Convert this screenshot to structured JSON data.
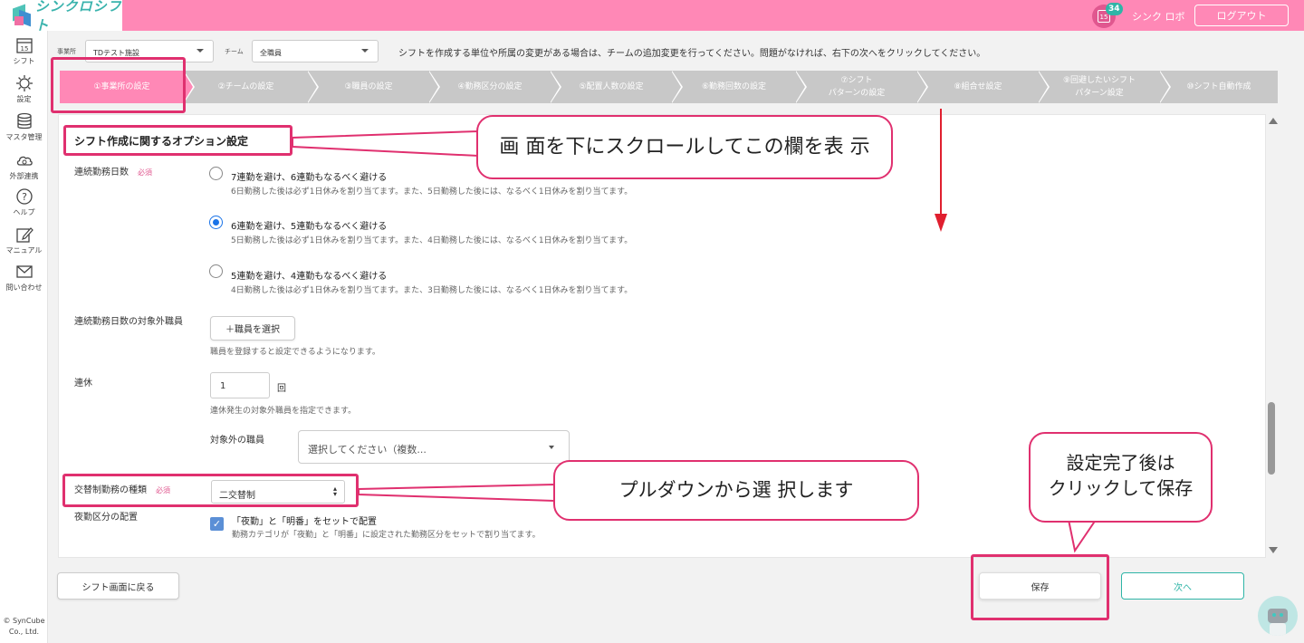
{
  "app": {
    "logo_text": "シンクロシフト",
    "calendar_day": "15",
    "notification_count": "34",
    "user_name": "シンク ロボ",
    "logout_label": "ログアウト",
    "brand_color": "#ff88b6",
    "accent_color": "#2fb5a7"
  },
  "sidebar": {
    "items": [
      {
        "label": "シフト",
        "icon": "calendar-icon",
        "day": "15"
      },
      {
        "label": "設定",
        "icon": "gear-icon"
      },
      {
        "label": "マスタ管理",
        "icon": "database-icon"
      },
      {
        "label": "外部連携",
        "icon": "cloud-sync-icon"
      },
      {
        "label": "ヘルプ",
        "icon": "help-icon"
      },
      {
        "label": "マニュアル",
        "icon": "edit-icon"
      },
      {
        "label": "問い合わせ",
        "icon": "mail-icon"
      }
    ],
    "copyright_line1": "© SynCube",
    "copyright_line2": "Co., Ltd."
  },
  "filters": {
    "office_label": "事業所",
    "office_value": "TDテスト施設",
    "team_label": "チーム",
    "team_value": "全職員",
    "instruction": "シフトを作成する単位や所属の変更がある場合は、チームの追加変更を行ってください。問題がなければ、右下の次へをクリックしてください。"
  },
  "steps": [
    {
      "label": "①事業所の設定",
      "active": true
    },
    {
      "label": "②チームの設定"
    },
    {
      "label": "③職員の設定"
    },
    {
      "label": "④勤務区分の設定"
    },
    {
      "label": "⑤配置人数の設定"
    },
    {
      "label": "⑥勤務回数の設定"
    },
    {
      "label": "⑦シフト",
      "label2": "パターンの設定"
    },
    {
      "label": "⑧組合せ設定"
    },
    {
      "label": "⑨回避したいシフト",
      "label2": "パターン設定"
    },
    {
      "label": "⑩シフト自動作成"
    }
  ],
  "form": {
    "section_title": "シフト作成に関するオプション設定",
    "required_tag": "必須",
    "consecutive": {
      "label": "連続勤務日数",
      "options": [
        {
          "title": "7連勤を避け、6連勤もなるべく避ける",
          "desc": "6日勤務した後は必ず1日休みを割り当てます。また、5日勤務した後には、なるべく1日休みを割り当てます。",
          "selected": false
        },
        {
          "title": "6連勤を避け、5連勤もなるべく避ける",
          "desc": "5日勤務した後は必ず1日休みを割り当てます。また、4日勤務した後には、なるべく1日休みを割り当てます。",
          "selected": true
        },
        {
          "title": "5連勤を避け、4連勤もなるべく避ける",
          "desc": "4日勤務した後は必ず1日休みを割り当てます。また、3日勤務した後には、なるべく1日休みを割り当てます。",
          "selected": false
        }
      ]
    },
    "excluded_staff": {
      "label": "連続勤務日数の対象外職員",
      "button": "＋職員を選択",
      "help": "職員を登録すると設定できるようになります。"
    },
    "renkyu": {
      "label": "連休",
      "value": "1",
      "unit": "回",
      "help": "連休発生の対象外職員を指定できます。",
      "excluded_label": "対象外の職員",
      "excluded_placeholder": "選択してください（複数..."
    },
    "kotai": {
      "label": "交替制勤務の種類",
      "value": "二交替制"
    },
    "night": {
      "label": "夜勤区分の配置",
      "check_label": "「夜勤」と「明番」をセットで配置",
      "check_desc": "勤務カテゴリが「夜勤」と「明番」に設定された勤務区分をセットで割り当てます。",
      "checked": true
    }
  },
  "footer": {
    "back_label": "シフト画面に戻る",
    "save_label": "保存",
    "next_label": "次へ"
  },
  "annotations": {
    "callout_scroll": "画 面を下にスクロールしてこの欄を表 示",
    "callout_dropdown": "プルダウンから選 択します",
    "callout_save_line1": "設定完了後は",
    "callout_save_line2": "クリックして保存",
    "highlight_color": "#e0306f"
  }
}
